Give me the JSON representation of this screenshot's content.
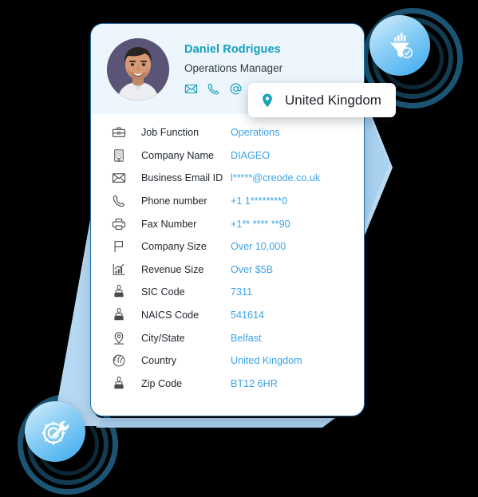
{
  "theme": {
    "page_background": "#000000",
    "card_background": "#ffffff",
    "card_header_background": "#eef6fd",
    "card_border": "#1f6fa8",
    "accent_teal": "#14a0bd",
    "value_blue": "#3ba3e8",
    "label_dark": "#20272e",
    "ring_dark": "#1c5573",
    "wing_blue": "#a9d5f2",
    "badge_gradient_from": "#d8effc",
    "badge_gradient_to": "#3aa9ef",
    "avatar_background": "#5a5477"
  },
  "card": {
    "profile": {
      "name": "Daniel Rodrigues",
      "title": "Operations Manager",
      "avatar_alt": "portrait-photo",
      "contact_icons": [
        {
          "name": "email-icon",
          "glyph": "envelope"
        },
        {
          "name": "phone-icon",
          "glyph": "phone"
        },
        {
          "name": "at-icon",
          "glyph": "at-sign"
        }
      ]
    },
    "details": [
      {
        "icon": "briefcase-icon",
        "label": "Job Function",
        "value": "Operations"
      },
      {
        "icon": "building-icon",
        "label": "Company Name",
        "value": "DIAGEO"
      },
      {
        "icon": "envelope-icon",
        "label": "Business Email ID",
        "value": "l*****@creode.co.uk"
      },
      {
        "icon": "phone-icon",
        "label": "Phone number",
        "value": "+1 1********0"
      },
      {
        "icon": "printer-icon",
        "label": "Fax Number",
        "value": "+1** **** **90"
      },
      {
        "icon": "flag-icon",
        "label": "Company Size",
        "value": "Over 10,000"
      },
      {
        "icon": "bar-chart-icon",
        "label": "Revenue Size",
        "value": "Over $5B"
      },
      {
        "icon": "stamp-icon",
        "label": "SIC Code",
        "value": "7311"
      },
      {
        "icon": "stamp-icon",
        "label": "NAICS Code",
        "value": "541614"
      },
      {
        "icon": "map-pin-icon",
        "label": "City/State",
        "value": "Belfast"
      },
      {
        "icon": "globe-icon",
        "label": "Country",
        "value": "United Kingdom"
      },
      {
        "icon": "stamp-icon",
        "label": "Zip Code",
        "value": "BT12 6HR"
      }
    ]
  },
  "country_pill": {
    "icon": "map-pin-icon",
    "label": "United Kingdom"
  },
  "badges": [
    {
      "name": "filter-verified-badge",
      "icon": "funnel-chart-check-icon",
      "position": "top-right"
    },
    {
      "name": "settings-tools-badge",
      "icon": "gear-wrench-icon",
      "position": "bottom-left"
    }
  ]
}
